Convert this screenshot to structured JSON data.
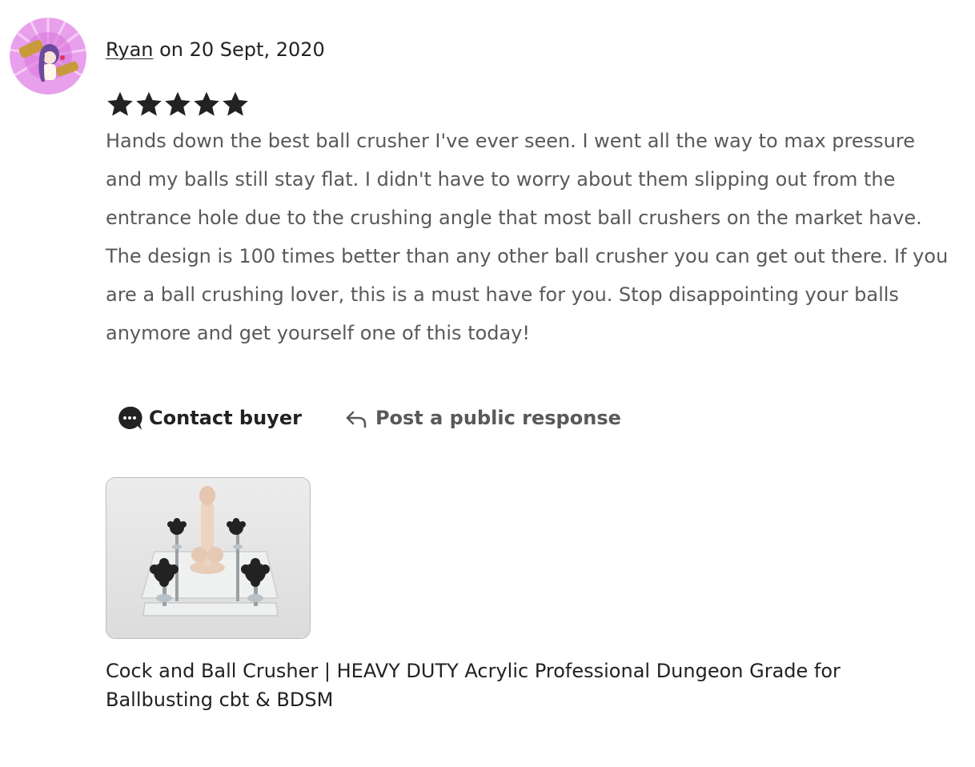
{
  "review": {
    "author": "Ryan",
    "date_prefix": " on ",
    "date": "20 Sept, 2020",
    "rating": 5,
    "rating_max": 5,
    "text": "Hands down the best ball crusher I've ever seen. I went all the way to max pressure and my balls still stay flat. I didn't have to worry about them slipping out from the entrance hole due to the crushing angle that most ball crushers on the market have. The design is 100 times better than any other ball crusher you can get out there. If you are a ball crushing lover, this is a must have for you. Stop disappointing your balls anymore and get yourself one of this today!"
  },
  "actions": {
    "contact_label": "Contact buyer",
    "contact_icon": "chat-bubble-icon",
    "respond_label": "Post a public response",
    "respond_icon": "reply-arrow-icon"
  },
  "listing": {
    "title": "Cock and Ball Crusher | HEAVY DUTY Acrylic Professional Dungeon Grade for Ballbusting cbt & BDSM",
    "image_icon": "product-thumbnail"
  },
  "colors": {
    "text_primary": "#222222",
    "text_secondary": "#595959",
    "star": "#222222",
    "avatar_bg": "#e67ee8"
  }
}
